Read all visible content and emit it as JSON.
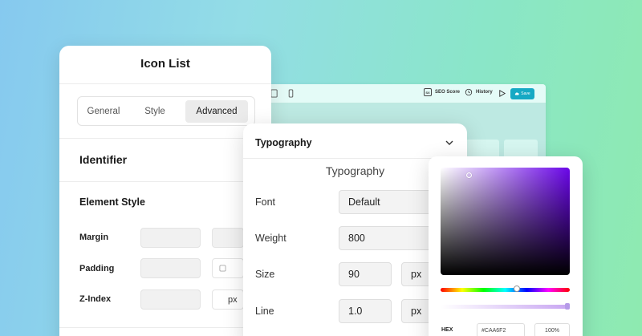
{
  "editor": {
    "toolbar": {
      "seo_badge": "SX",
      "seo_label": "SEO Score",
      "history_label": "History",
      "save_label": "Save"
    }
  },
  "icon_list_panel": {
    "title": "Icon List",
    "tabs": [
      {
        "label": "General",
        "active": false
      },
      {
        "label": "Style",
        "active": false
      },
      {
        "label": "Advanced",
        "active": true
      }
    ],
    "identifier_heading": "Identifier",
    "element_style_heading": "Element Style",
    "rows": [
      {
        "label": "Margin"
      },
      {
        "label": "Padding"
      },
      {
        "label": "Z-Index",
        "unit": "px"
      }
    ]
  },
  "typography_panel": {
    "header": "Typography",
    "subtitle": "Typography",
    "fields": {
      "font": {
        "label": "Font",
        "value": "Default"
      },
      "weight": {
        "label": "Weight",
        "value": "800"
      },
      "size": {
        "label": "Size",
        "value": "90",
        "unit": "px"
      },
      "line": {
        "label": "Line",
        "value": "1.0",
        "unit": "px"
      }
    }
  },
  "color_picker": {
    "hex_label": "HEX",
    "hex_value": "#CAA6F2",
    "alpha_value": "100%",
    "colors": {
      "base_hue": "#6a06e8",
      "selected": "#CAA6F2"
    }
  },
  "colors": {
    "accent": "#16a9c4",
    "background_start": "#86c9ef",
    "background_end": "#8eeab0"
  }
}
